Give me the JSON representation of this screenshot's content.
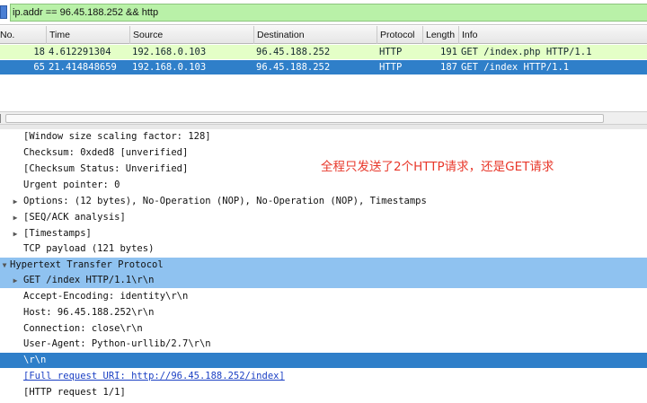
{
  "filter": {
    "value": "ip.addr == 96.45.188.252 && http"
  },
  "packet_list": {
    "columns": [
      "No.",
      "Time",
      "Source",
      "Destination",
      "Protocol",
      "Length",
      "Info"
    ],
    "rows": [
      {
        "no": "18",
        "time": "4.612291304",
        "source": "192.168.0.103",
        "destination": "96.45.188.252",
        "protocol": "HTTP",
        "length": "191",
        "info": "GET /index.php HTTP/1.1",
        "color": "#e4ffc7"
      },
      {
        "no": "65",
        "time": "21.414848659",
        "source": "192.168.0.103",
        "destination": "96.45.188.252",
        "protocol": "HTTP",
        "length": "187",
        "info": "GET /index HTTP/1.1",
        "color": "#2f7fc9"
      }
    ]
  },
  "details": [
    {
      "text": "[Window size scaling factor: 128]",
      "expander": ""
    },
    {
      "text": "Checksum: 0xded8 [unverified]",
      "expander": ""
    },
    {
      "text": "[Checksum Status: Unverified]",
      "expander": ""
    },
    {
      "text": "Urgent pointer: 0",
      "expander": ""
    },
    {
      "text": "Options: (12 bytes), No-Operation (NOP), No-Operation (NOP), Timestamps",
      "expander": "collapsed"
    },
    {
      "text": "[SEQ/ACK analysis]",
      "expander": "collapsed"
    },
    {
      "text": "[Timestamps]",
      "expander": "collapsed"
    },
    {
      "text": "TCP payload (121 bytes)",
      "expander": ""
    },
    {
      "text": "Hypertext Transfer Protocol",
      "expander": "expanded"
    },
    {
      "text": "GET /index HTTP/1.1\\r\\n",
      "expander": "collapsed"
    },
    {
      "text": "Accept-Encoding: identity\\r\\n",
      "expander": ""
    },
    {
      "text": "Host: 96.45.188.252\\r\\n",
      "expander": ""
    },
    {
      "text": "Connection: close\\r\\n",
      "expander": ""
    },
    {
      "text": "User-Agent: Python-urllib/2.7\\r\\n",
      "expander": ""
    },
    {
      "text": "\\r\\n",
      "expander": ""
    },
    {
      "text": "[Full request URI: http://96.45.188.252/index]",
      "expander": ""
    },
    {
      "text": "[HTTP request 1/1]",
      "expander": ""
    }
  ],
  "annotation": "全程只发送了2个HTTP请求，还是GET请求",
  "icons": {
    "expanded": "triangle-down",
    "collapsed": "triangle-right"
  },
  "colors": {
    "filter_valid": "#b9f1a8",
    "selected_row": "#2f7fc9",
    "http_row": "#e4ffc7",
    "annotation": "#e8382b"
  }
}
